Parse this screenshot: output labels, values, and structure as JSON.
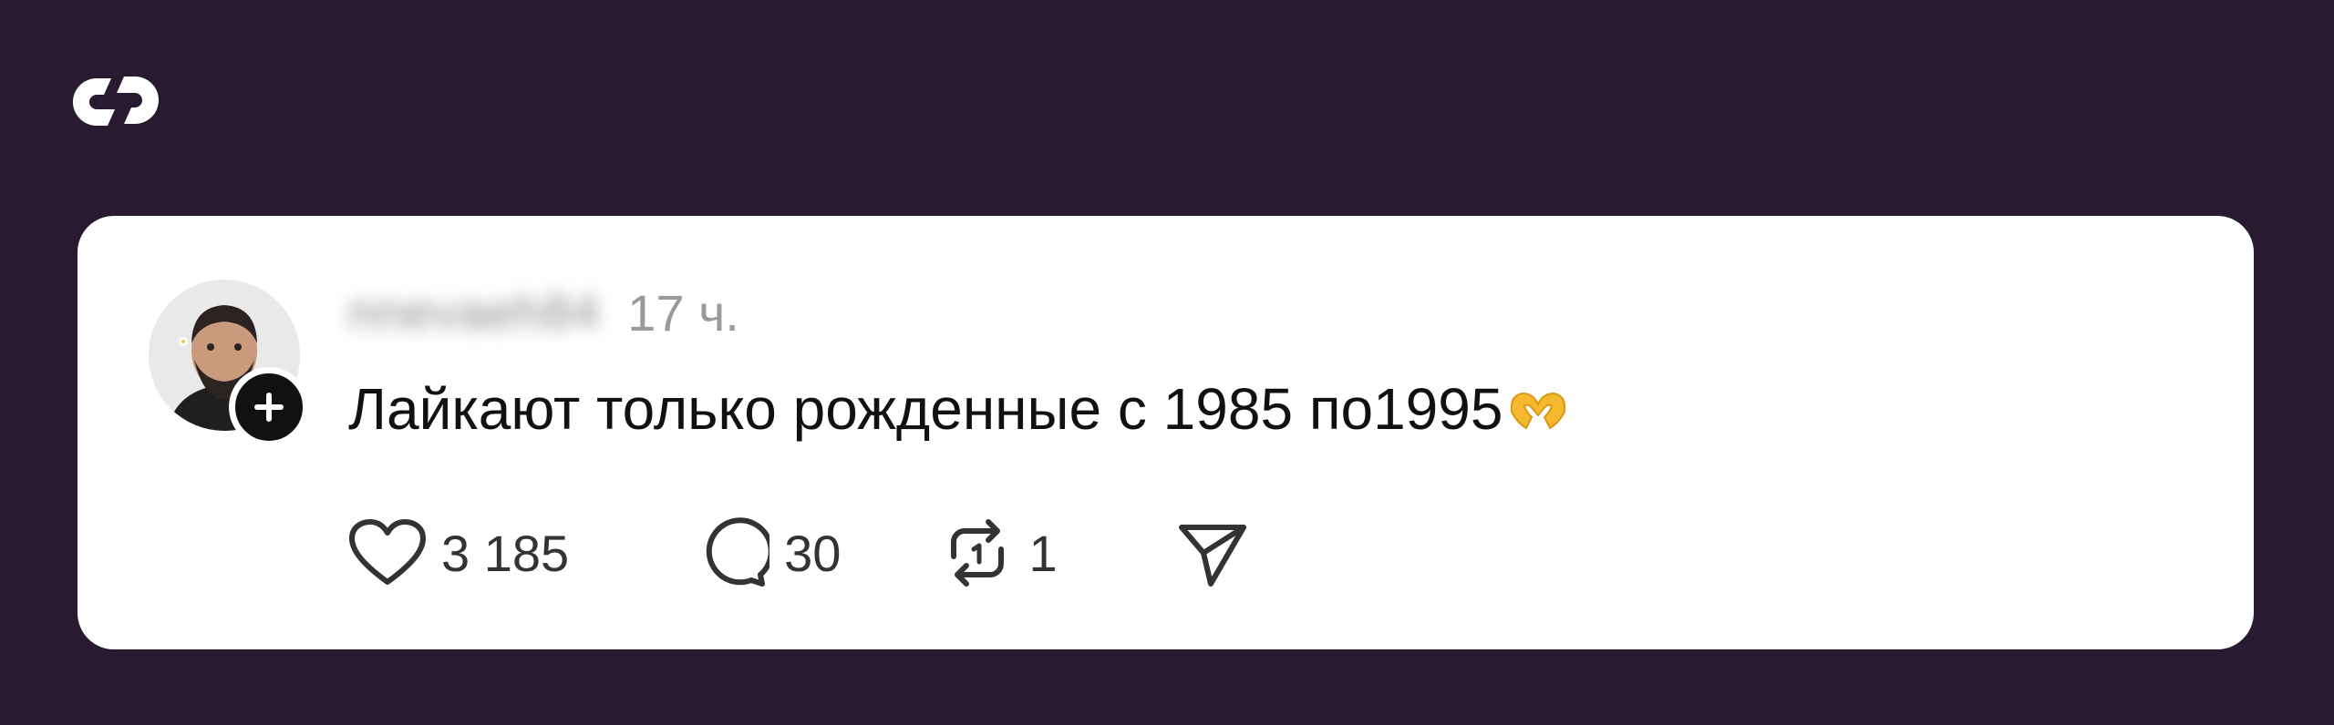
{
  "post": {
    "username": "nnevaeh84",
    "time": "17 ч.",
    "text": "Лайкают только рожденные с 1985 по1995"
  },
  "actions": {
    "likes": "3 185",
    "comments": "30",
    "reposts": "1"
  },
  "colors": {
    "background": "#271a31",
    "card": "#ffffff",
    "text": "#111111",
    "muted": "#9a9a9a",
    "emoji": "#f5b82e"
  },
  "icons": [
    "threads-logo",
    "avatar",
    "follow-plus-icon",
    "heart-icon",
    "comment-icon",
    "repost-icon",
    "share-icon",
    "heart-hands-emoji"
  ]
}
